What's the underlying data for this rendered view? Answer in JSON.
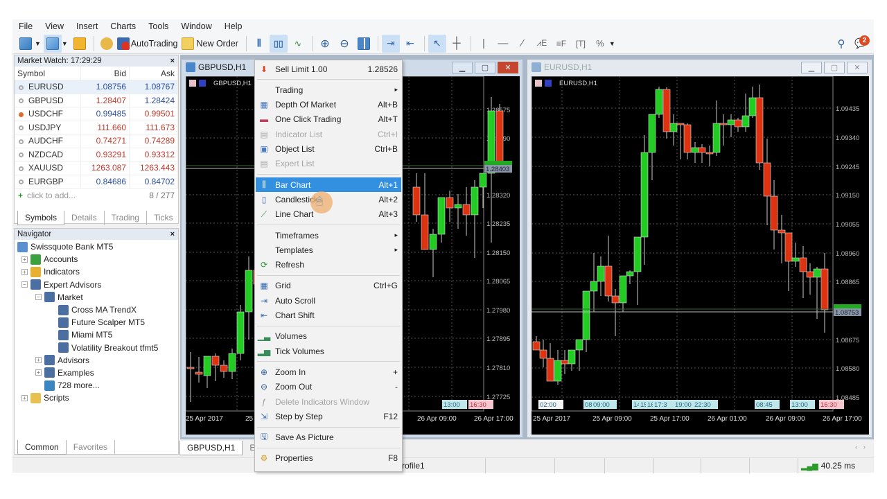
{
  "menubar": [
    "File",
    "View",
    "Insert",
    "Charts",
    "Tools",
    "Window",
    "Help"
  ],
  "toolbar": {
    "autotrading_label": "AutoTrading",
    "new_order_label": "New Order",
    "notification_count": "2"
  },
  "market_watch": {
    "title": "Market Watch: 17:29:29",
    "columns": [
      "Symbol",
      "Bid",
      "Ask"
    ],
    "rows": [
      {
        "symbol": "EURUSD",
        "bid": "1.08756",
        "ask": "1.08767",
        "bid_color": "blue",
        "ask_color": "blue",
        "up": false
      },
      {
        "symbol": "GBPUSD",
        "bid": "1.28407",
        "ask": "1.28424",
        "bid_color": "red",
        "ask_color": "blue",
        "up": false
      },
      {
        "symbol": "USDCHF",
        "bid": "0.99485",
        "ask": "0.99501",
        "bid_color": "blue",
        "ask_color": "red",
        "up": true
      },
      {
        "symbol": "USDJPY",
        "bid": "111.660",
        "ask": "111.673",
        "bid_color": "red",
        "ask_color": "red",
        "up": false
      },
      {
        "symbol": "AUDCHF",
        "bid": "0.74271",
        "ask": "0.74289",
        "bid_color": "red",
        "ask_color": "red",
        "up": false
      },
      {
        "symbol": "NZDCAD",
        "bid": "0.93291",
        "ask": "0.93312",
        "bid_color": "red",
        "ask_color": "red",
        "up": false
      },
      {
        "symbol": "XAUUSD",
        "bid": "1263.087",
        "ask": "1263.443",
        "bid_color": "red",
        "ask_color": "red",
        "up": false
      },
      {
        "symbol": "EURGBP",
        "bid": "0.84686",
        "ask": "0.84702",
        "bid_color": "blue",
        "ask_color": "blue",
        "up": false
      }
    ],
    "add_label": "click to add...",
    "count": "8 / 277",
    "tabs": [
      "Symbols",
      "Details",
      "Trading",
      "Ticks"
    ]
  },
  "navigator": {
    "title": "Navigator",
    "items": [
      {
        "label": "Swissquote Bank MT5",
        "level": 0,
        "toggle": ""
      },
      {
        "label": "Accounts",
        "level": 1,
        "toggle": "+"
      },
      {
        "label": "Indicators",
        "level": 1,
        "toggle": "+"
      },
      {
        "label": "Expert Advisors",
        "level": 1,
        "toggle": "-"
      },
      {
        "label": "Market",
        "level": 2,
        "toggle": "-"
      },
      {
        "label": "Cross MA TrendX",
        "level": 3,
        "toggle": ""
      },
      {
        "label": "Future Scalper MT5",
        "level": 3,
        "toggle": ""
      },
      {
        "label": "Miami MT5",
        "level": 3,
        "toggle": ""
      },
      {
        "label": "Volatility Breakout tfmt5",
        "level": 3,
        "toggle": ""
      },
      {
        "label": "Advisors",
        "level": 2,
        "toggle": "+"
      },
      {
        "label": "Examples",
        "level": 2,
        "toggle": "+"
      },
      {
        "label": "728 more...",
        "level": 2,
        "toggle": ""
      },
      {
        "label": "Scripts",
        "level": 1,
        "toggle": "+"
      }
    ],
    "tabs": [
      "Common",
      "Favorites"
    ]
  },
  "charts": [
    {
      "window_title": "GBPUSD,H1",
      "label": "GBPUSD,H1",
      "active": true,
      "price_ticks": [
        "1.28575",
        "1.28490",
        "1.28320",
        "1.28235",
        "1.28150",
        "1.28065",
        "1.27980",
        "1.27895",
        "1.27810",
        "1.27725"
      ],
      "bid_label": "1.28403",
      "time_labels": [
        "25 Apr 2017",
        "25",
        "26 Apr 09:00",
        "26 Apr 17:00"
      ],
      "session_tags": [
        {
          "text": "13:00",
          "kind": "blue"
        },
        {
          "text": "16:30",
          "kind": "pink"
        }
      ]
    },
    {
      "window_title": "EURUSD,H1",
      "label": "EURUSD,H1",
      "active": false,
      "price_ticks": [
        "1.09435",
        "1.09340",
        "1.09245",
        "1.09150",
        "1.09055",
        "1.08960",
        "1.08865",
        "1.08675",
        "1.08580",
        "1.08485"
      ],
      "bid_label": "1.08753",
      "time_labels": [
        "25 Apr 2017",
        "25 Apr 09:00",
        "25 Apr 17:00",
        "26 Apr 01:00",
        "26 Apr 09:00",
        "26 Apr 17:00"
      ],
      "session_tags": [
        {
          "text": "02:00",
          "kind": "white"
        },
        {
          "text": "08",
          "kind": "blue"
        },
        {
          "text": "09:00",
          "kind": "blue"
        },
        {
          "text": "14",
          "kind": "blue"
        },
        {
          "text": "15",
          "kind": "blue"
        },
        {
          "text": "16",
          "kind": "blue"
        },
        {
          "text": "17:3",
          "kind": "blue"
        },
        {
          "text": "19:00",
          "kind": "blue"
        },
        {
          "text": "22:30",
          "kind": "blue"
        },
        {
          "text": "08:45",
          "kind": "blue"
        },
        {
          "text": "13:00",
          "kind": "blue"
        },
        {
          "text": "16:30",
          "kind": "pink"
        }
      ]
    }
  ],
  "chart_tabs": [
    "GBPUSD,H1",
    "EU"
  ],
  "context_menu": {
    "items": [
      {
        "type": "item",
        "icon": "sell-limit-icon",
        "label": "Sell Limit 1.00",
        "shortcut": "1.28526"
      },
      {
        "type": "sep"
      },
      {
        "type": "item",
        "icon": "",
        "label": "Trading",
        "shortcut": "▸"
      },
      {
        "type": "item",
        "icon": "depth-of-market-icon",
        "label": "Depth Of Market",
        "shortcut": "Alt+B"
      },
      {
        "type": "item",
        "icon": "one-click-trading-icon",
        "label": "One Click Trading",
        "shortcut": "Alt+T"
      },
      {
        "type": "item",
        "icon": "indicator-list-icon",
        "label": "Indicator List",
        "shortcut": "Ctrl+I",
        "disabled": true
      },
      {
        "type": "item",
        "icon": "object-list-icon",
        "label": "Object List",
        "shortcut": "Ctrl+B"
      },
      {
        "type": "item",
        "icon": "expert-list-icon",
        "label": "Expert List",
        "shortcut": "",
        "disabled": true
      },
      {
        "type": "sep"
      },
      {
        "type": "item",
        "icon": "bar-chart-icon",
        "label": "Bar Chart",
        "shortcut": "Alt+1",
        "highlighted": true
      },
      {
        "type": "item",
        "icon": "candlesticks-icon",
        "label": "Candlesticks",
        "shortcut": "Alt+2"
      },
      {
        "type": "item",
        "icon": "line-chart-icon",
        "label": "Line Chart",
        "shortcut": "Alt+3"
      },
      {
        "type": "sep"
      },
      {
        "type": "item",
        "icon": "",
        "label": "Timeframes",
        "shortcut": "▸"
      },
      {
        "type": "item",
        "icon": "",
        "label": "Templates",
        "shortcut": "▸"
      },
      {
        "type": "item",
        "icon": "refresh-icon",
        "label": "Refresh",
        "shortcut": ""
      },
      {
        "type": "sep"
      },
      {
        "type": "item",
        "icon": "grid-icon",
        "label": "Grid",
        "shortcut": "Ctrl+G"
      },
      {
        "type": "item",
        "icon": "auto-scroll-icon",
        "label": "Auto Scroll",
        "shortcut": ""
      },
      {
        "type": "item",
        "icon": "chart-shift-icon",
        "label": "Chart Shift",
        "shortcut": ""
      },
      {
        "type": "sep"
      },
      {
        "type": "item",
        "icon": "volumes-icon",
        "label": "Volumes",
        "shortcut": ""
      },
      {
        "type": "item",
        "icon": "tick-volumes-icon",
        "label": "Tick Volumes",
        "shortcut": ""
      },
      {
        "type": "sep"
      },
      {
        "type": "item",
        "icon": "zoom-in-icon",
        "label": "Zoom In",
        "shortcut": "+"
      },
      {
        "type": "item",
        "icon": "zoom-out-icon",
        "label": "Zoom Out",
        "shortcut": "-"
      },
      {
        "type": "item",
        "icon": "delete-indicators-window-icon",
        "label": "Delete Indicators Window",
        "shortcut": "",
        "disabled": true
      },
      {
        "type": "item",
        "icon": "step-by-step-icon",
        "label": "Step by Step",
        "shortcut": "F12"
      },
      {
        "type": "sep"
      },
      {
        "type": "item",
        "icon": "save-as-picture-icon",
        "label": "Save As Picture",
        "shortcut": ""
      },
      {
        "type": "sep"
      },
      {
        "type": "item",
        "icon": "properties-icon",
        "label": "Properties",
        "shortcut": "F8"
      }
    ]
  },
  "statusbar": {
    "profile": "rofile1",
    "ping": "40.25 ms"
  },
  "colors": {
    "bull": "#22cc22",
    "bear": "#dd3311",
    "highlight": "#3390e0"
  }
}
